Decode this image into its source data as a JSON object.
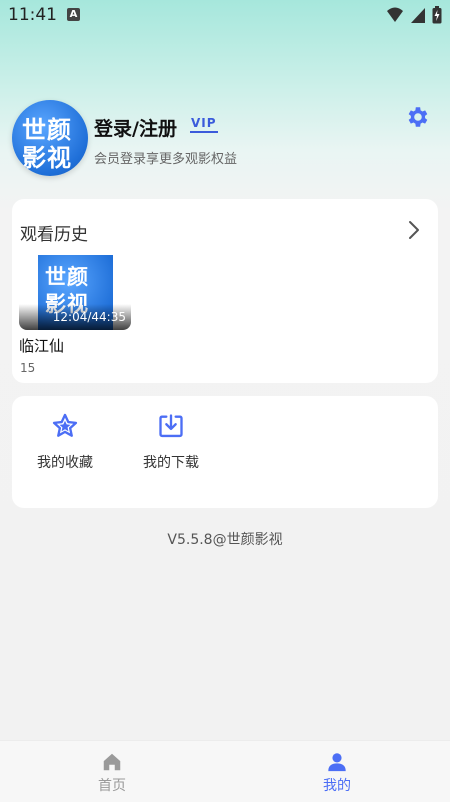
{
  "status_bar": {
    "time": "11:41",
    "indicator": "A"
  },
  "profile": {
    "avatar_logo_line1": "世颜",
    "avatar_logo_line2": "影视",
    "login_title": "登录/注册",
    "vip_label": "VIP",
    "subtitle": "会员登录享更多观影权益",
    "settings_icon": "gear-icon"
  },
  "history": {
    "title": "观看历史",
    "items": [
      {
        "name": "临江仙",
        "progress": "12:04/44:35",
        "episode": "15",
        "logo_line1": "世颜",
        "logo_line2": "影视"
      }
    ]
  },
  "functions": [
    {
      "label": "我的收藏",
      "icon": "star-icon"
    },
    {
      "label": "我的下载",
      "icon": "download-icon"
    }
  ],
  "version": "V5.5.8@世颜影视",
  "tabbar": {
    "tabs": [
      {
        "label": "首页",
        "icon": "home-icon",
        "active": false
      },
      {
        "label": "我的",
        "icon": "user-icon",
        "active": true
      }
    ],
    "active_color": "#4c6ef5",
    "inactive_color": "#9a9a9a"
  },
  "colors": {
    "accent": "#3b5bdb",
    "icon_blue": "#4c6ef5"
  }
}
